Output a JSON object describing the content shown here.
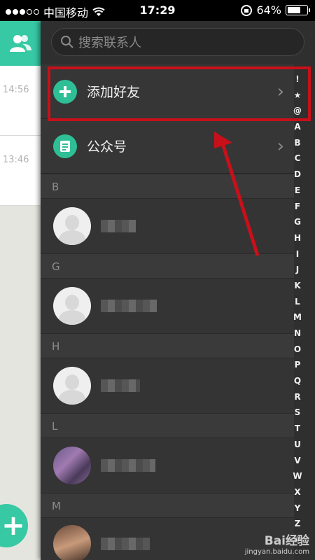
{
  "status": {
    "carrier": "中国移动",
    "time": "17:29",
    "battery_text": "64%",
    "battery_level": 0.64
  },
  "chat_list": {
    "times": [
      "14:56",
      "13:46"
    ],
    "fab_label": "+"
  },
  "search": {
    "placeholder": "搜索联系人"
  },
  "rows": {
    "add_friend": "添加好友",
    "official": "公众号"
  },
  "sections": [
    {
      "letter": "B"
    },
    {
      "letter": "G"
    },
    {
      "letter": "H"
    },
    {
      "letter": "L"
    },
    {
      "letter": "M"
    }
  ],
  "index_letters": [
    "!",
    "★",
    "@",
    "A",
    "B",
    "C",
    "D",
    "E",
    "F",
    "G",
    "H",
    "I",
    "J",
    "K",
    "L",
    "M",
    "N",
    "O",
    "P",
    "Q",
    "R",
    "S",
    "T",
    "U",
    "V",
    "W",
    "X",
    "Y",
    "Z",
    "#"
  ],
  "watermark": {
    "brand": "Bai经验",
    "url": "jingyan.baidu.com"
  },
  "colors": {
    "accent": "#37c8a4",
    "annotation": "#c8101a"
  }
}
